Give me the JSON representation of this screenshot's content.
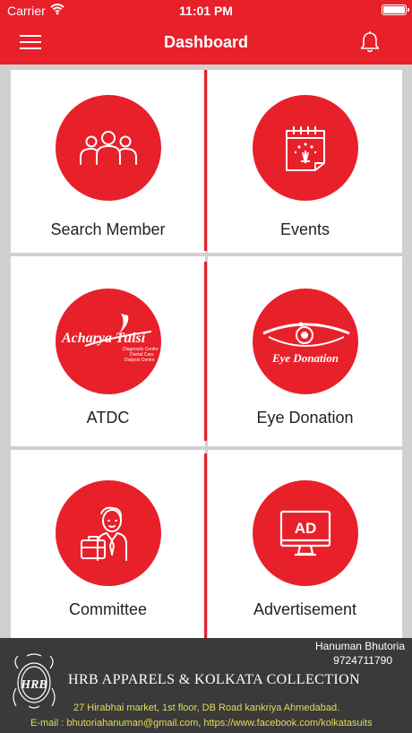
{
  "status_bar": {
    "carrier": "Carrier",
    "time": "11:01 PM"
  },
  "header": {
    "title": "Dashboard",
    "menu_icon": "hamburger-icon",
    "notification_icon": "bell-icon"
  },
  "tiles": [
    {
      "label": "Search Member",
      "icon": "group-icon"
    },
    {
      "label": "Events",
      "icon": "calendar-icon"
    },
    {
      "label": "ATDC",
      "icon": "acharya-tulsi-logo",
      "logo_text": "Acharya Tulsi",
      "logo_lines": [
        "Diagnostic Centre",
        "Dental Care",
        "Dialysis Centre"
      ]
    },
    {
      "label": "Eye Donation",
      "icon": "eye-donation-logo",
      "logo_text": "Eye Donation"
    },
    {
      "label": "Committee",
      "icon": "businessman-icon"
    },
    {
      "label": "Advertisement",
      "icon": "ad-monitor-icon",
      "icon_text": "AD"
    }
  ],
  "footer": {
    "contact_name": "Hanuman Bhutoria",
    "contact_phone": "9724711790",
    "logo_text": "HRB",
    "company": "HRB APPARELS & KOLKATA COLLECTION",
    "address": "27 Hirabhai market, 1st floor, DB Road kankriya Ahmedabad.",
    "email_line": "E-mail : bhutoriahanuman@gmail.com, https://www.facebook.com/kolkatasuits"
  },
  "colors": {
    "brand_red": "#e8202a",
    "footer_bg": "#3a3a3a",
    "footer_text_yellow": "#e0dd5a"
  }
}
